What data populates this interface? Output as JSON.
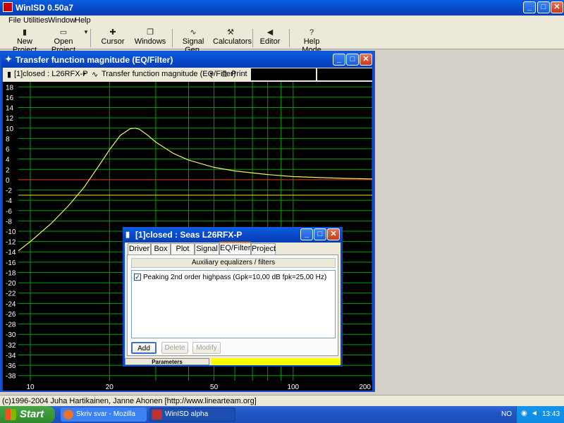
{
  "app": {
    "title": "WinISD 0.50a7",
    "minimize": "_",
    "maximize": "□",
    "close": "✕"
  },
  "menu": [
    "File",
    "Utilities",
    "Window",
    "Help"
  ],
  "toolbar": [
    {
      "label": "New Project",
      "icon": "new-project-icon"
    },
    {
      "label": "Open Project",
      "icon": "open-folder-icon"
    },
    {
      "label": "Cursor",
      "icon": "cursor-icon"
    },
    {
      "label": "Windows",
      "icon": "windows-icon"
    },
    {
      "label": "Signal Gen.",
      "icon": "signal-wave-icon"
    },
    {
      "label": "Calculators",
      "icon": "calculator-icon"
    },
    {
      "label": "Editor",
      "icon": "speaker-editor-icon"
    },
    {
      "label": "Help Mode",
      "icon": "help-question-icon"
    }
  ],
  "tf_window": {
    "title": "Transfer function magnitude (EQ/Filter)",
    "project_select": "[1]closed : L26RFX-P",
    "graph_select": "Transfer function magnitude (EQ/Filter)",
    "print_label": "Print"
  },
  "chart_data": {
    "type": "line",
    "xscale": "log",
    "xlim": [
      9,
      200
    ],
    "ylim": [
      -39,
      19
    ],
    "yticks": [
      18,
      16,
      14,
      12,
      10,
      8,
      6,
      4,
      2,
      0,
      -2,
      -4,
      -6,
      -8,
      -10,
      -12,
      -14,
      -16,
      -18,
      -20,
      -22,
      -24,
      -26,
      -28,
      -30,
      -32,
      -34,
      -36,
      -38
    ],
    "xtick_labels": [
      {
        "x": 10,
        "label": "10"
      },
      {
        "x": 20,
        "label": "20"
      },
      {
        "x": 50,
        "label": "50"
      },
      {
        "x": 100,
        "label": "100"
      },
      {
        "x": 200,
        "label": "200"
      }
    ],
    "xgrid": [
      10,
      20,
      30,
      40,
      50,
      60,
      70,
      80,
      90,
      100,
      200
    ],
    "reference_lines": [
      {
        "y": 0,
        "color": "#e02020"
      },
      {
        "y": -3,
        "color": "#e8e830"
      }
    ],
    "series": [
      {
        "color": "#f0f060",
        "x": [
          9,
          10,
          12,
          14,
          16,
          18,
          20,
          22,
          24,
          25,
          26,
          28,
          30,
          35,
          40,
          50,
          60,
          80,
          100,
          130,
          160,
          200
        ],
        "y": [
          -13.8,
          -12.0,
          -8.5,
          -5.0,
          -1.5,
          2.3,
          5.8,
          8.6,
          9.9,
          10.0,
          9.8,
          8.6,
          7.3,
          5.1,
          3.8,
          2.4,
          1.7,
          1.0,
          0.6,
          0.4,
          0.25,
          0.15
        ]
      }
    ],
    "grid": true,
    "grid_color": "#00a000"
  },
  "dialog": {
    "title": "[1]closed : Seas L26RFX-P",
    "tabs": [
      "Driver",
      "Box",
      "Plot",
      "Signal",
      "EQ/Filter",
      "Project"
    ],
    "active_tab": "EQ/Filter",
    "aux_header": "Auxiliary equalizers / filters",
    "eq_item": "Peaking 2nd order highpass (Gpk=10,00 dB fpk=25,00 Hz)",
    "eq_checked": "✓",
    "buttons": {
      "add": "Add",
      "delete": "Delete",
      "modify": "Modify"
    },
    "status_label": "Parameters"
  },
  "status_bar": "(c)1996-2004 Juha Hartikainen, Janne Ahonen [http://www.linearteam.org]",
  "taskbar": {
    "start": "Start",
    "tasks": [
      "Skriv svar - Mozilla Fir...",
      "WinISD alpha"
    ],
    "lang": "NO",
    "clock": "13:43"
  }
}
